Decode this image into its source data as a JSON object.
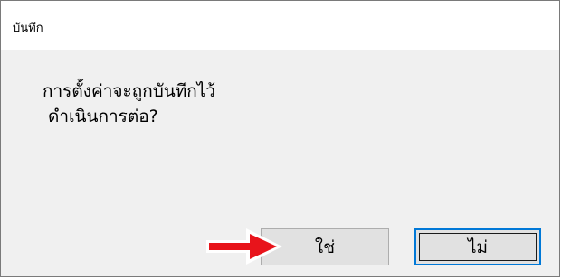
{
  "window": {
    "title": "บันทึก"
  },
  "message": {
    "line1": "การตั้งค่าจะถูกบันทึกไว้",
    "line2": "ดำเนินการต่อ?"
  },
  "buttons": {
    "yes_label": "ใช่",
    "no_label": "ไม่"
  },
  "annotation": {
    "arrow_color": "#e8141b",
    "arrow_icon": "right-arrow-icon"
  },
  "colors": {
    "title_bg": "#ffffff",
    "body_bg": "#f0f0f0",
    "focus_border": "#0078d7"
  }
}
